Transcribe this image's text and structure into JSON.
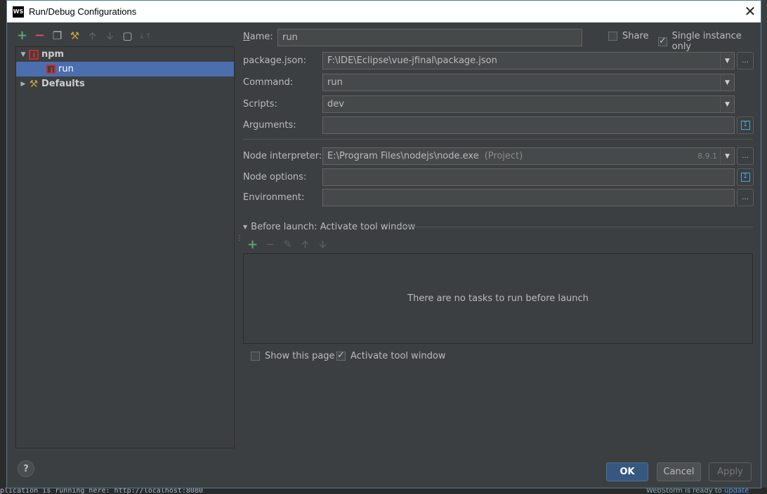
{
  "window": {
    "title": "Run/Debug Configurations",
    "app_icon_text": "WS",
    "close_glyph": "✕"
  },
  "toolbar_left": {
    "icons": [
      "add-icon",
      "remove-icon",
      "copy-icon",
      "edit-defaults-icon",
      "move-up-icon",
      "move-down-icon",
      "folder-icon",
      "sort-icon"
    ]
  },
  "tree": {
    "nodes": [
      {
        "label": "npm",
        "expanded": true
      },
      {
        "label": "run",
        "selected": true
      },
      {
        "label": "Defaults",
        "expanded": false
      }
    ]
  },
  "form": {
    "name_label": "Name:",
    "name_value": "run",
    "share_label": "Share",
    "share_checked": false,
    "single_instance_label": "Single instance only",
    "single_instance_checked": true,
    "package_json_label": "package.json:",
    "package_json_value": "F:\\IDE\\Eclipse\\vue-jfinal\\package.json",
    "command_label": "Command:",
    "command_value": "run",
    "scripts_label": "Scripts:",
    "scripts_value": "dev",
    "arguments_label": "Arguments:",
    "arguments_value": "",
    "node_interpreter_label": "Node interpreter:",
    "node_interpreter_value": "E:\\Program Files\\nodejs\\node.exe",
    "node_interpreter_scope": "(Project)",
    "node_version": "8.9.1",
    "node_options_label": "Node options:",
    "node_options_value": "",
    "environment_label": "Environment:",
    "environment_value": "",
    "ellipsis": "..."
  },
  "before_launch": {
    "title": "Before launch: Activate tool window",
    "empty_text": "There are no tasks to run before launch",
    "icons": [
      "add-task-icon",
      "remove-task-icon",
      "edit-task-icon",
      "move-task-up-icon",
      "move-task-down-icon"
    ]
  },
  "options": {
    "show_this_page_label": "Show this page",
    "show_this_page_checked": false,
    "activate_tool_window_label": "Activate tool window",
    "activate_tool_window_checked": true
  },
  "buttons": {
    "help": "?",
    "ok": "OK",
    "cancel": "Cancel",
    "apply": "Apply"
  },
  "background": {
    "console_text": "plication is running here: http://localhost:8080",
    "status_text": "WebStorm is ready to ",
    "status_link": "update"
  },
  "colors": {
    "selection": "#4b6eaf",
    "primary_button": "#365880",
    "npm_red": "#c62d2d",
    "add_green": "#59a869",
    "remove_red": "#c75450"
  }
}
